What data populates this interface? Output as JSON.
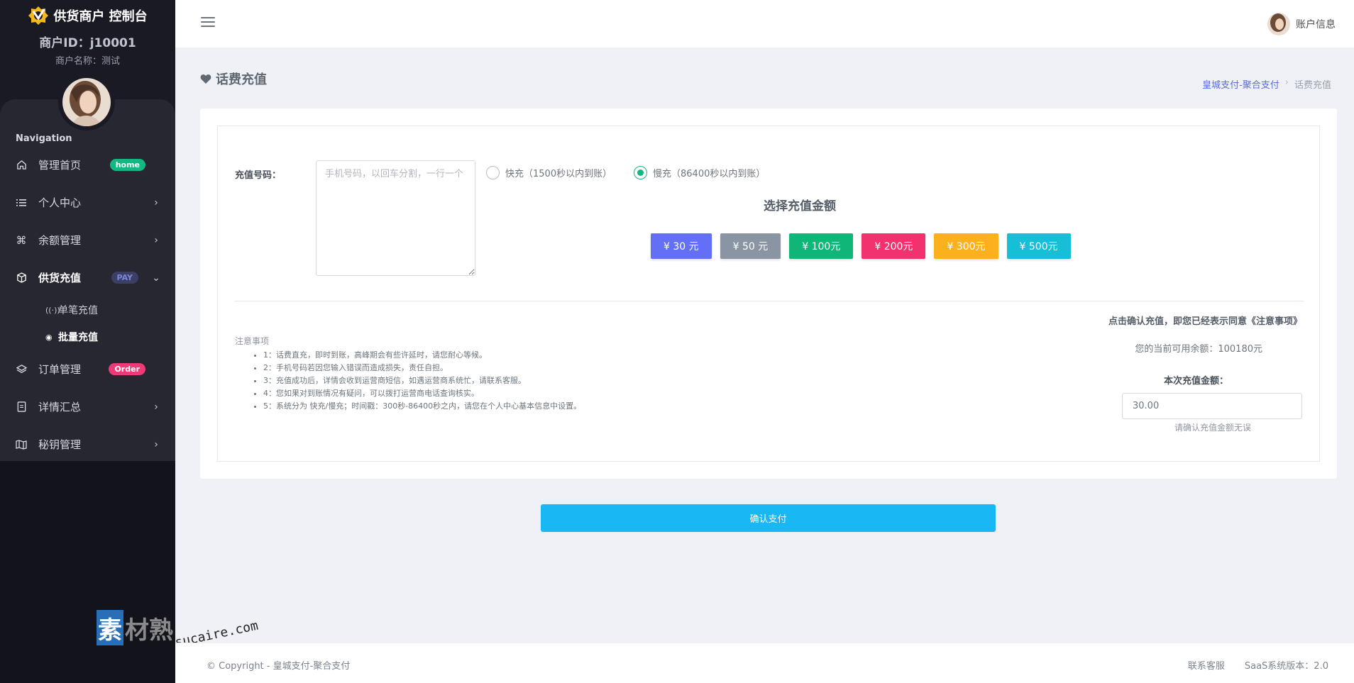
{
  "sidebar": {
    "brand": "供货商户 控制台",
    "merchant_id": "商户ID：j10001",
    "merchant_name": "商户名称：测试",
    "nav_title": "Navigation",
    "items": [
      {
        "label": "管理首页",
        "badge": "home",
        "icon": "home-icon"
      },
      {
        "label": "个人中心",
        "icon": "list-icon"
      },
      {
        "label": "余额管理",
        "icon": "command-icon"
      },
      {
        "label": "供货充值",
        "badge": "PAY",
        "icon": "box-icon"
      },
      {
        "label": "订单管理",
        "badge": "Order",
        "icon": "layers-icon"
      },
      {
        "label": "详情汇总",
        "icon": "clipboard-icon"
      },
      {
        "label": "秘钥管理",
        "icon": "map-icon"
      }
    ],
    "sub_items": [
      {
        "label": "单笔充值",
        "icon": "radio-tower-icon"
      },
      {
        "label": "批量充值",
        "icon": "circle-icon"
      }
    ]
  },
  "topbar": {
    "account": "账户信息"
  },
  "page": {
    "title": "话费充值",
    "breadcrumb": [
      "皇城支付-聚合支付",
      "话费充值"
    ]
  },
  "form": {
    "number_label": "充值号码：",
    "number_placeholder": "手机号码，以回车分割，一行一个",
    "radio_fast": "快充（1500秒以内到账）",
    "radio_slow": "慢充（86400秒以内到账）",
    "selected_mode": "slow",
    "amount_title": "选择充值金额",
    "amounts": [
      {
        "label": "¥ 30 元",
        "color": "#6370f5"
      },
      {
        "label": "¥ 50 元",
        "color": "#8995a3"
      },
      {
        "label": "¥ 100元",
        "color": "#0fb678"
      },
      {
        "label": "¥ 200元",
        "color": "#f1326f"
      },
      {
        "label": "¥ 300元",
        "color": "#fbb11e"
      },
      {
        "label": "¥ 500元",
        "color": "#16bfd6"
      }
    ],
    "notice_title": "注意事项",
    "notices": [
      "1：话费直充，即时到账，高峰期会有些许延时，请您耐心等候。",
      "2：手机号码若因您输入错误而造成损失，责任自担。",
      "3：充值成功后，详情会收到运营商短信，如遇运营商系统忙，请联系客服。",
      "4：您如果对到账情况有疑问，可以拨打运营商电话查询核实。",
      "5：系统分为 快充/慢充；时间戳：300秒-86400秒之内，请您在个人中心基本信息中设置。"
    ],
    "agree_text": "点击确认充值，即您已经表示同意《注意事项》",
    "balance_text": "您的当前可用余额：100180元",
    "charge_label": "本次充值金额：",
    "charge_value": "30.00",
    "charge_hint": "请确认充值金额无误",
    "confirm_label": "确认支付"
  },
  "footer": {
    "copyright": "© Copyright - 皇城支付-聚合支付",
    "contact": "联系客服",
    "version": "SaaS系统版本：2.0"
  },
  "watermark": {
    "cn": "素材熟",
    "en": "sucaire.com"
  }
}
